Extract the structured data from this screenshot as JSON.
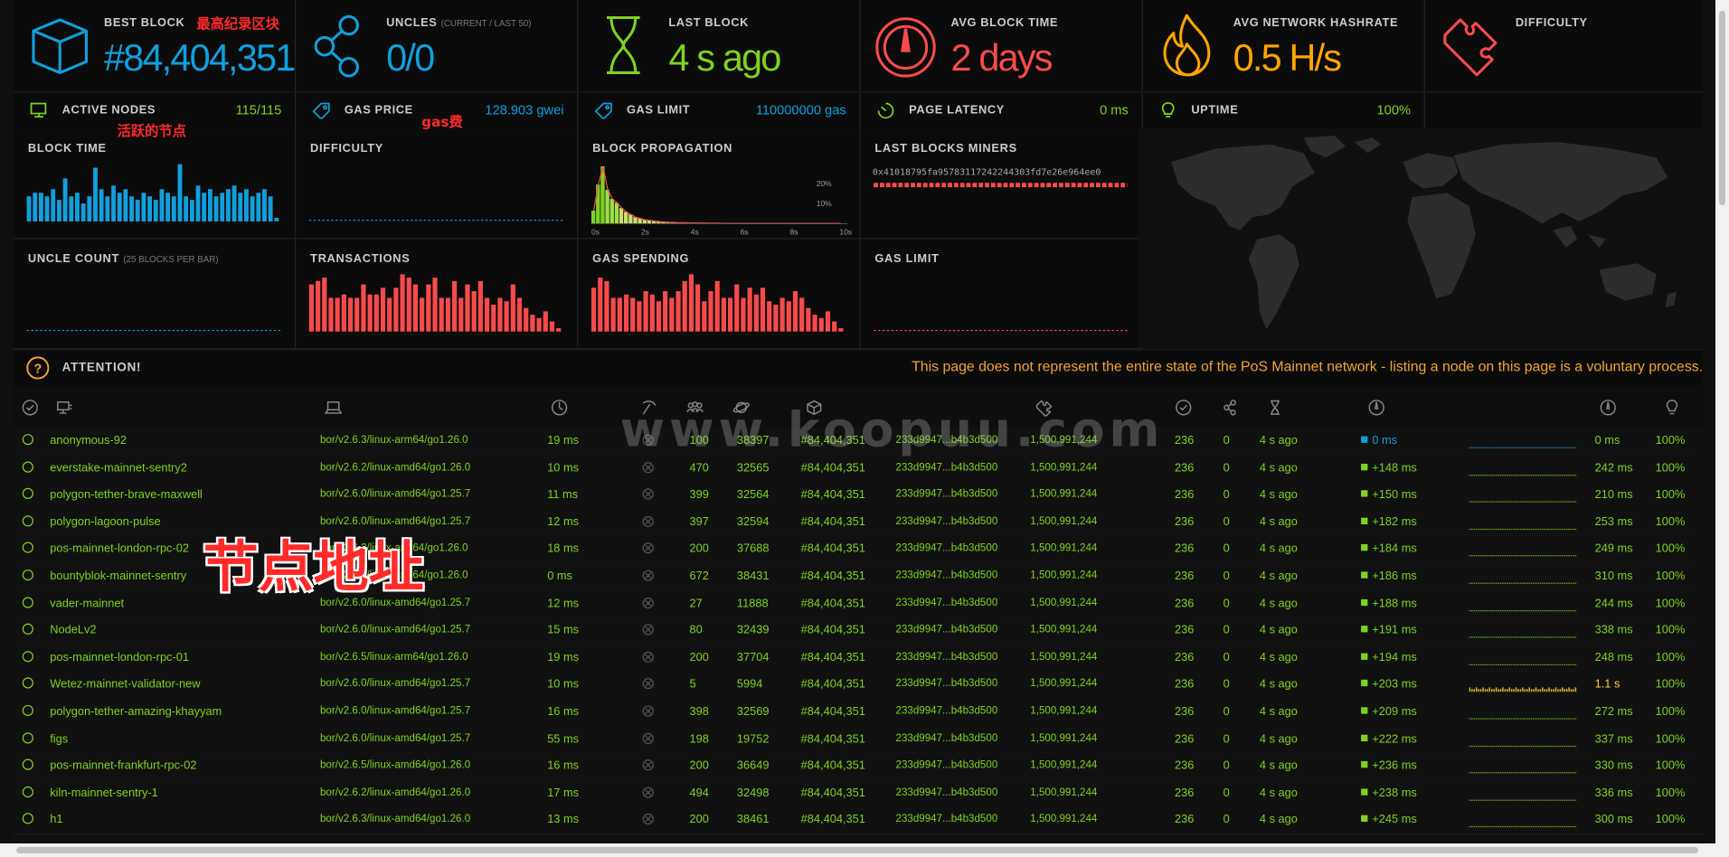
{
  "stats": [
    {
      "label": "BEST BLOCK",
      "sub": "",
      "value": "#84,404,351",
      "color": "#10a0de",
      "icon": "cube-icon"
    },
    {
      "label": "UNCLES",
      "sub": "(CURRENT / LAST 50)",
      "value": "0/0",
      "color": "#10a0de",
      "icon": "uncles-icon"
    },
    {
      "label": "LAST BLOCK",
      "sub": "",
      "value": "4 s ago",
      "color": "#7ed321",
      "icon": "hourglass-icon"
    },
    {
      "label": "AVG BLOCK TIME",
      "sub": "",
      "value": "2 days",
      "color": "#f74b4b",
      "icon": "gauge-icon"
    },
    {
      "label": "AVG NETWORK HASHRATE",
      "sub": "",
      "value": "0.5 H/s",
      "color": "#ffa500",
      "icon": "flame-icon"
    },
    {
      "label": "DIFFICULTY",
      "sub": "",
      "value": "",
      "color": "#f74b4b",
      "icon": "puzzle-icon"
    }
  ],
  "mini_stats": [
    {
      "label": "ACTIVE NODES",
      "value": "115/115",
      "color": "#7ed321",
      "icon": "monitor-icon"
    },
    {
      "label": "GAS PRICE",
      "value": "128.903 gwei",
      "color": "#10a0de",
      "icon": "tag-icon"
    },
    {
      "label": "GAS LIMIT",
      "value": "110000000 gas",
      "color": "#10a0de",
      "icon": "tag-icon"
    },
    {
      "label": "PAGE LATENCY",
      "value": "0 ms",
      "color": "#7ed321",
      "icon": "timer-icon"
    },
    {
      "label": "UPTIME",
      "value": "100%",
      "color": "#7ed321",
      "icon": "bulb-icon"
    }
  ],
  "charts": {
    "block_time": {
      "title": "BLOCK TIME",
      "values": [
        7,
        8,
        8,
        7,
        9,
        6,
        12,
        7,
        8,
        5,
        7,
        15,
        9,
        7,
        10,
        8,
        9,
        7,
        6,
        8,
        7,
        6,
        9,
        8,
        7,
        16,
        7,
        6,
        10,
        8,
        9,
        7,
        8,
        9,
        10,
        8,
        9,
        7,
        8,
        9,
        7,
        1
      ],
      "color": "#10a0de"
    },
    "difficulty": {
      "title": "DIFFICULTY",
      "color": "#10a0de"
    },
    "block_propagation": {
      "title": "BLOCK PROPAGATION",
      "xticks": [
        "0s",
        "2s",
        "4s",
        "6s",
        "8s",
        "10s"
      ],
      "yticks": [
        "20%",
        "10%"
      ],
      "values": [
        10,
        30,
        44,
        26,
        19,
        16,
        12,
        9,
        7,
        5,
        4,
        3,
        2.5,
        2,
        1.6,
        1.3,
        1,
        0.9,
        0.8,
        0.7,
        0.6,
        0.5,
        0.5,
        0.4,
        0.4,
        0.3,
        0.3,
        0.3,
        0.2,
        0.2,
        0.2,
        0.2,
        0.2,
        0.2,
        0.2,
        0.2,
        0.2,
        0.2,
        0.2,
        0.2,
        0.2,
        0.2,
        0.2,
        0.2,
        0.2,
        0.2,
        0.2,
        0.2,
        0.2,
        0.2,
        0.2,
        0.2,
        0.2,
        0.2
      ],
      "color": "#7ed321"
    },
    "last_blocks_miners": {
      "title": "LAST BLOCKS MINERS",
      "address": "0x41018795fa95783117242244303fd7e26e964ee0",
      "color": "#f74b4b"
    },
    "uncle_count": {
      "title": "UNCLE COUNT",
      "sub": "(25 BLOCKS PER BAR)",
      "color": "#10a0de"
    },
    "transactions": {
      "title": "TRANSACTIONS",
      "values": [
        14,
        15,
        16,
        10,
        10,
        11,
        10,
        10,
        14,
        11,
        11,
        13,
        10,
        13,
        17,
        16,
        14,
        10,
        14,
        16,
        10,
        10,
        15,
        10,
        14,
        12,
        15,
        10,
        8,
        10,
        9,
        14,
        10,
        7,
        5,
        4,
        6,
        3,
        1
      ],
      "color": "#f74b4b"
    },
    "gas_spending": {
      "title": "GAS SPENDING",
      "values": [
        13,
        16,
        15,
        10,
        10,
        11,
        10,
        9,
        12,
        11,
        9,
        12,
        10,
        12,
        15,
        17,
        14,
        9,
        12,
        15,
        10,
        10,
        14,
        10,
        13,
        11,
        13,
        9,
        8,
        10,
        9,
        12,
        10,
        7,
        5,
        4,
        6,
        3,
        1
      ],
      "color": "#f74b4b"
    },
    "gas_limit": {
      "title": "GAS LIMIT",
      "color": "#f74b4b"
    }
  },
  "attention": {
    "title": "ATTENTION!",
    "message": "This page does not represent the entire state of the PoS Mainnet network - listing a node on this page is a voluntary process."
  },
  "nodes": [
    {
      "name": "anonymous-92",
      "client": "bor/v2.6.3/linux-arm64/go1.26.0",
      "latency": "19 ms",
      "peers": "100",
      "pending": "38397",
      "block": "#84,404,351",
      "hash": "233d9947...b4b3d500",
      "difficulty": "1,500,991,244",
      "txs": "236",
      "uncles": "0",
      "last": "4 s ago",
      "prop": "0 ms",
      "avg_prop": "0 ms",
      "uptime": "100%",
      "prop_color": "#10a0de"
    },
    {
      "name": "everstake-mainnet-sentry2",
      "client": "bor/v2.6.2/linux-amd64/go1.26.0",
      "latency": "10 ms",
      "peers": "470",
      "pending": "32565",
      "block": "#84,404,351",
      "hash": "233d9947...b4b3d500",
      "difficulty": "1,500,991,244",
      "txs": "236",
      "uncles": "0",
      "last": "4 s ago",
      "prop": "+148 ms",
      "avg_prop": "242 ms",
      "uptime": "100%",
      "prop_color": "#7ed321"
    },
    {
      "name": "polygon-tether-brave-maxwell",
      "client": "bor/v2.6.0/linux-amd64/go1.25.7",
      "latency": "11 ms",
      "peers": "399",
      "pending": "32564",
      "block": "#84,404,351",
      "hash": "233d9947...b4b3d500",
      "difficulty": "1,500,991,244",
      "txs": "236",
      "uncles": "0",
      "last": "4 s ago",
      "prop": "+150 ms",
      "avg_prop": "210 ms",
      "uptime": "100%",
      "prop_color": "#7ed321"
    },
    {
      "name": "polygon-lagoon-pulse",
      "client": "bor/v2.6.0/linux-amd64/go1.25.7",
      "latency": "12 ms",
      "peers": "397",
      "pending": "32594",
      "block": "#84,404,351",
      "hash": "233d9947...b4b3d500",
      "difficulty": "1,500,991,244",
      "txs": "236",
      "uncles": "0",
      "last": "4 s ago",
      "prop": "+182 ms",
      "avg_prop": "253 ms",
      "uptime": "100%",
      "prop_color": "#7ed321"
    },
    {
      "name": "pos-mainnet-london-rpc-02",
      "client": "bor/v2.6.3/linux-arm64/go1.26.0",
      "latency": "18 ms",
      "peers": "200",
      "pending": "37688",
      "block": "#84,404,351",
      "hash": "233d9947...b4b3d500",
      "difficulty": "1,500,991,244",
      "txs": "236",
      "uncles": "0",
      "last": "4 s ago",
      "prop": "+184 ms",
      "avg_prop": "249 ms",
      "uptime": "100%",
      "prop_color": "#7ed321"
    },
    {
      "name": "bountyblok-mainnet-sentry",
      "client": "bor/v2.6.3/linux-arm64/go1.26.0",
      "latency": "0 ms",
      "peers": "672",
      "pending": "38431",
      "block": "#84,404,351",
      "hash": "233d9947...b4b3d500",
      "difficulty": "1,500,991,244",
      "txs": "236",
      "uncles": "0",
      "last": "4 s ago",
      "prop": "+186 ms",
      "avg_prop": "310 ms",
      "uptime": "100%",
      "prop_color": "#7ed321"
    },
    {
      "name": "vader-mainnet",
      "client": "bor/v2.6.0/linux-amd64/go1.25.7",
      "latency": "12 ms",
      "peers": "27",
      "pending": "11888",
      "block": "#84,404,351",
      "hash": "233d9947...b4b3d500",
      "difficulty": "1,500,991,244",
      "txs": "236",
      "uncles": "0",
      "last": "4 s ago",
      "prop": "+188 ms",
      "avg_prop": "244 ms",
      "uptime": "100%",
      "prop_color": "#7ed321"
    },
    {
      "name": "NodeLv2",
      "client": "bor/v2.6.0/linux-amd64/go1.25.7",
      "latency": "15 ms",
      "peers": "80",
      "pending": "32439",
      "block": "#84,404,351",
      "hash": "233d9947...b4b3d500",
      "difficulty": "1,500,991,244",
      "txs": "236",
      "uncles": "0",
      "last": "4 s ago",
      "prop": "+191 ms",
      "avg_prop": "338 ms",
      "uptime": "100%",
      "prop_color": "#7ed321"
    },
    {
      "name": "pos-mainnet-london-rpc-01",
      "client": "bor/v2.6.5/linux-arm64/go1.26.0",
      "latency": "19 ms",
      "peers": "200",
      "pending": "37704",
      "block": "#84,404,351",
      "hash": "233d9947...b4b3d500",
      "difficulty": "1,500,991,244",
      "txs": "236",
      "uncles": "0",
      "last": "4 s ago",
      "prop": "+194 ms",
      "avg_prop": "248 ms",
      "uptime": "100%",
      "prop_color": "#7ed321"
    },
    {
      "name": "Wetez-mainnet-validator-new",
      "client": "bor/v2.6.0/linux-amd64/go1.25.7",
      "latency": "10 ms",
      "peers": "5",
      "pending": "5994",
      "block": "#84,404,351",
      "hash": "233d9947...b4b3d500",
      "difficulty": "1,500,991,244",
      "txs": "236",
      "uncles": "0",
      "last": "4 s ago",
      "prop": "+203 ms",
      "avg_prop": "1.1 s",
      "uptime": "100%",
      "prop_color": "#7ed321",
      "avg_color": "#ffd43b"
    },
    {
      "name": "polygon-tether-amazing-khayyam",
      "client": "bor/v2.6.0/linux-amd64/go1.25.7",
      "latency": "16 ms",
      "peers": "398",
      "pending": "32569",
      "block": "#84,404,351",
      "hash": "233d9947...b4b3d500",
      "difficulty": "1,500,991,244",
      "txs": "236",
      "uncles": "0",
      "last": "4 s ago",
      "prop": "+209 ms",
      "avg_prop": "272 ms",
      "uptime": "100%",
      "prop_color": "#7ed321"
    },
    {
      "name": "figs",
      "client": "bor/v2.6.0/linux-amd64/go1.25.7",
      "latency": "55 ms",
      "peers": "198",
      "pending": "19752",
      "block": "#84,404,351",
      "hash": "233d9947...b4b3d500",
      "difficulty": "1,500,991,244",
      "txs": "236",
      "uncles": "0",
      "last": "4 s ago",
      "prop": "+222 ms",
      "avg_prop": "337 ms",
      "uptime": "100%",
      "prop_color": "#7ed321"
    },
    {
      "name": "pos-mainnet-frankfurt-rpc-02",
      "client": "bor/v2.6.5/linux-amd64/go1.26.0",
      "latency": "16 ms",
      "peers": "200",
      "pending": "36649",
      "block": "#84,404,351",
      "hash": "233d9947...b4b3d500",
      "difficulty": "1,500,991,244",
      "txs": "236",
      "uncles": "0",
      "last": "4 s ago",
      "prop": "+236 ms",
      "avg_prop": "330 ms",
      "uptime": "100%",
      "prop_color": "#7ed321"
    },
    {
      "name": "kiln-mainnet-sentry-1",
      "client": "bor/v2.6.2/linux-amd64/go1.26.0",
      "latency": "17 ms",
      "peers": "494",
      "pending": "32498",
      "block": "#84,404,351",
      "hash": "233d9947...b4b3d500",
      "difficulty": "1,500,991,244",
      "txs": "236",
      "uncles": "0",
      "last": "4 s ago",
      "prop": "+238 ms",
      "avg_prop": "336 ms",
      "uptime": "100%",
      "prop_color": "#7ed321"
    },
    {
      "name": "h1",
      "client": "bor/v2.6.3/linux-amd64/go1.26.0",
      "latency": "13 ms",
      "peers": "200",
      "pending": "38461",
      "block": "#84,404,351",
      "hash": "233d9947...b4b3d500",
      "difficulty": "1,500,991,244",
      "txs": "236",
      "uncles": "0",
      "last": "4 s ago",
      "prop": "+245 ms",
      "avg_prop": "300 ms",
      "uptime": "100%",
      "prop_color": "#7ed321"
    }
  ],
  "annotations": {
    "best_block": "最高纪录区块",
    "active_nodes": "活跃的节点",
    "gas_price": "gas费",
    "node_address": "节点地址"
  },
  "watermark": "www.koopuu.com"
}
